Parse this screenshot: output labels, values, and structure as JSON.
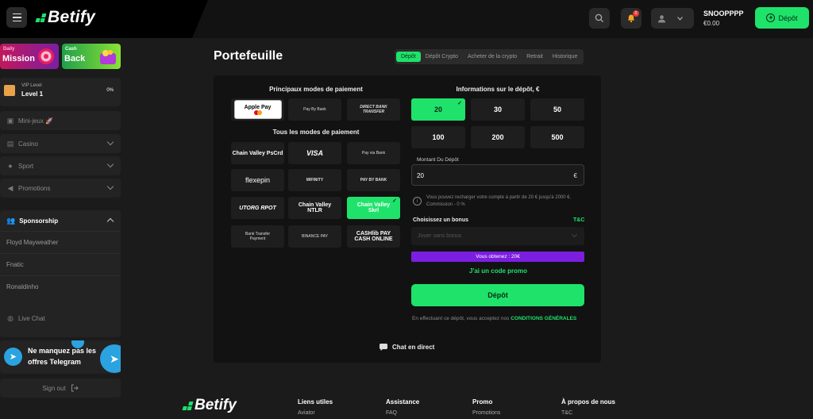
{
  "header": {
    "brand": "Betify",
    "username": "SNOOPPPP",
    "balance": "€0.00",
    "deposit_label": "Dépôt",
    "notif_count": "0"
  },
  "sidebar": {
    "daily_small": "Daily",
    "daily_big": "Mission",
    "cash_small": "Cash",
    "cash_big": "Back",
    "vip_label": "VIP Level",
    "vip_level": "Level 1",
    "vip_progress": "0%",
    "items": [
      {
        "label": "Mini-jeux 🚀"
      },
      {
        "label": "Casino"
      },
      {
        "label": "Sport"
      },
      {
        "label": "Promotions"
      }
    ],
    "sponsorship": {
      "title": "Sponsorship",
      "subs": [
        "Floyd Mayweather",
        "Fnatic",
        "Ronaldinho"
      ]
    },
    "live_chat": "Live Chat",
    "telegram_text": "Ne manquez pas les offres Telegram",
    "signout": "Sign out"
  },
  "main": {
    "title": "Portefeuille",
    "tabs": [
      "Dépôt",
      "Dépôt Crypto",
      "Acheter de la crypto",
      "Retrait",
      "Historique"
    ],
    "active_tab": "Dépôt",
    "main_methods_title": "Principaux modes de paiement",
    "all_methods_title": "Tous les modes de paiement",
    "main_methods": [
      "Apple Pay",
      "Pay By Bank",
      "DIRECT BANK TRANSFER"
    ],
    "all_methods": [
      [
        "Chain Valley PsCrd",
        "VISA",
        "Pay via Bank"
      ],
      [
        "flexepin",
        "MIFINITY",
        "PAY BY BANK"
      ],
      [
        "UTORG RPOT",
        "Chain Valley NTLR",
        "Chain Valley Skrl"
      ],
      [
        "Bank Transfer Payment",
        "BINANCE PAY",
        "CASHlib PAY CASH ONLINE"
      ]
    ],
    "deposit_info_title": "Informations sur le dépôt, €",
    "amounts": [
      "20",
      "30",
      "50",
      "100",
      "200",
      "500"
    ],
    "selected_amount": "20",
    "amount_label": "Montant Du Dépôt",
    "amount_value": "20",
    "currency": "€",
    "info_text": "Vous pouvez recharger votre compte à partir de 20 € jusqu'à 2000 €. Commission - 0 %",
    "bonus_label": "Choisissez un bonus",
    "tnc": "T&C",
    "bonus_placeholder": "Jouer sans bonus",
    "bonus_gain": "Vous obtenez : 20€",
    "promo_code": "J'ai un code promo",
    "deposit_button": "Dépôt",
    "terms_text": "En effectuant ce dépôt, vous acceptez nos ",
    "terms_link": "CONDITIONS GÉNÉRALES",
    "live_chat": "Chat en direct"
  },
  "footer": {
    "brand": "Betify",
    "columns": [
      {
        "head": "Liens utiles",
        "link": "Aviator"
      },
      {
        "head": "Assistance",
        "link": "FAQ"
      },
      {
        "head": "Promo",
        "link": "Promotions"
      },
      {
        "head": "À propos de nous",
        "link": "T&C"
      }
    ]
  },
  "colors": {
    "accent": "#1fe26b",
    "bonus": "#7b1ee0",
    "background": "#1b1b1b",
    "panel": "#121212"
  }
}
